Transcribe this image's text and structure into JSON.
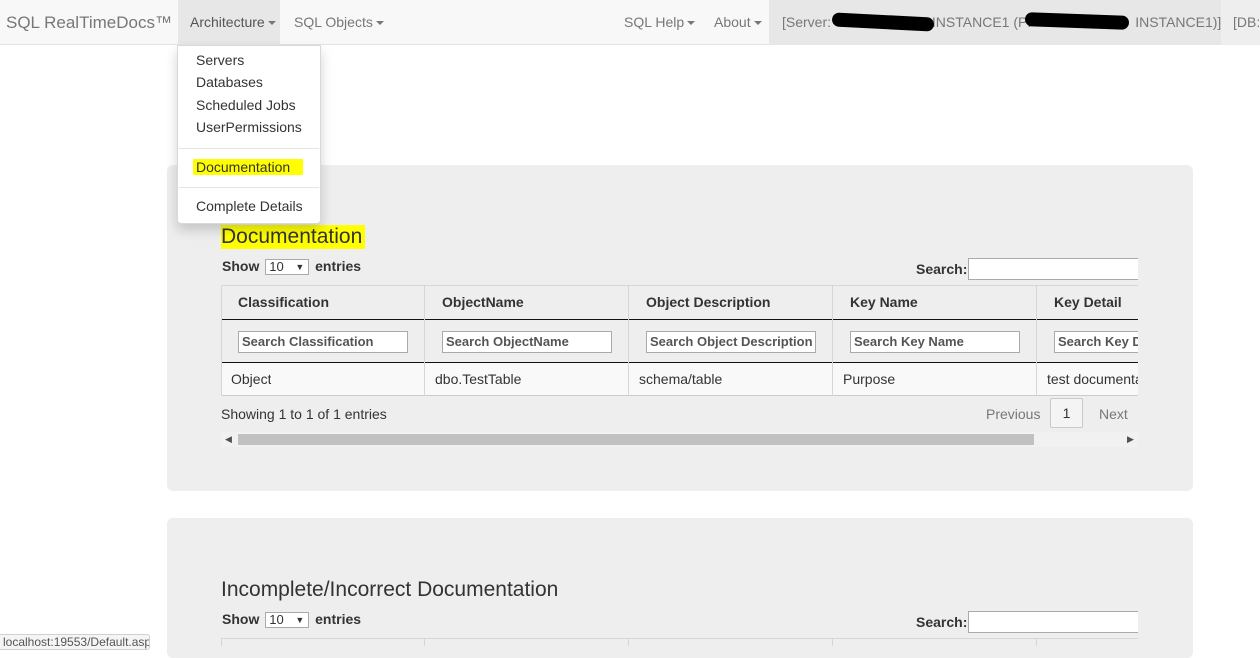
{
  "navbar": {
    "brand": "SQL RealTimeDocs™",
    "menus": [
      {
        "label": "Architecture"
      },
      {
        "label": "SQL Objects"
      },
      {
        "label": "SQL Help"
      },
      {
        "label": "About"
      }
    ],
    "server_prefix": "[Server: ",
    "server_mid": "INSTANCE1 (P:",
    "server_suffix": "INSTANCE1)]",
    "db_label": "[DB:"
  },
  "architecture_menu": {
    "items_group1": [
      "Servers",
      "Databases",
      "Scheduled Jobs",
      "UserPermissions"
    ],
    "highlighted_item": "Documentation",
    "items_group3": [
      "Complete Details"
    ]
  },
  "documentation": {
    "title": "Documentation",
    "show_label": "Show",
    "page_length": "10",
    "entries_label": "entries",
    "search_label": "Search:",
    "columns": [
      "Classification",
      "ObjectName",
      "Object Description",
      "Key Name",
      "Key Detail"
    ],
    "column_search_placeholders": [
      "Search Classification",
      "Search ObjectName",
      "Search Object Description",
      "Search Key Name",
      "Search Key De"
    ],
    "rows": [
      [
        "Object",
        "dbo.TestTable",
        "schema/table",
        "Purpose",
        "test documentati"
      ]
    ],
    "info": "Showing 1 to 1 of 1 entries",
    "pagination": {
      "previous": "Previous",
      "current": "1",
      "next": "Next"
    }
  },
  "incomplete": {
    "title": "Incomplete/Incorrect Documentation",
    "show_label": "Show",
    "page_length": "10",
    "entries_label": "entries",
    "search_label": "Search:"
  },
  "statusbar": {
    "url": "localhost:19553/Default.aspx"
  },
  "colors": {
    "highlight": "#ffff00",
    "panel": "#eeeeee",
    "navbar": "#f8f8f8"
  }
}
